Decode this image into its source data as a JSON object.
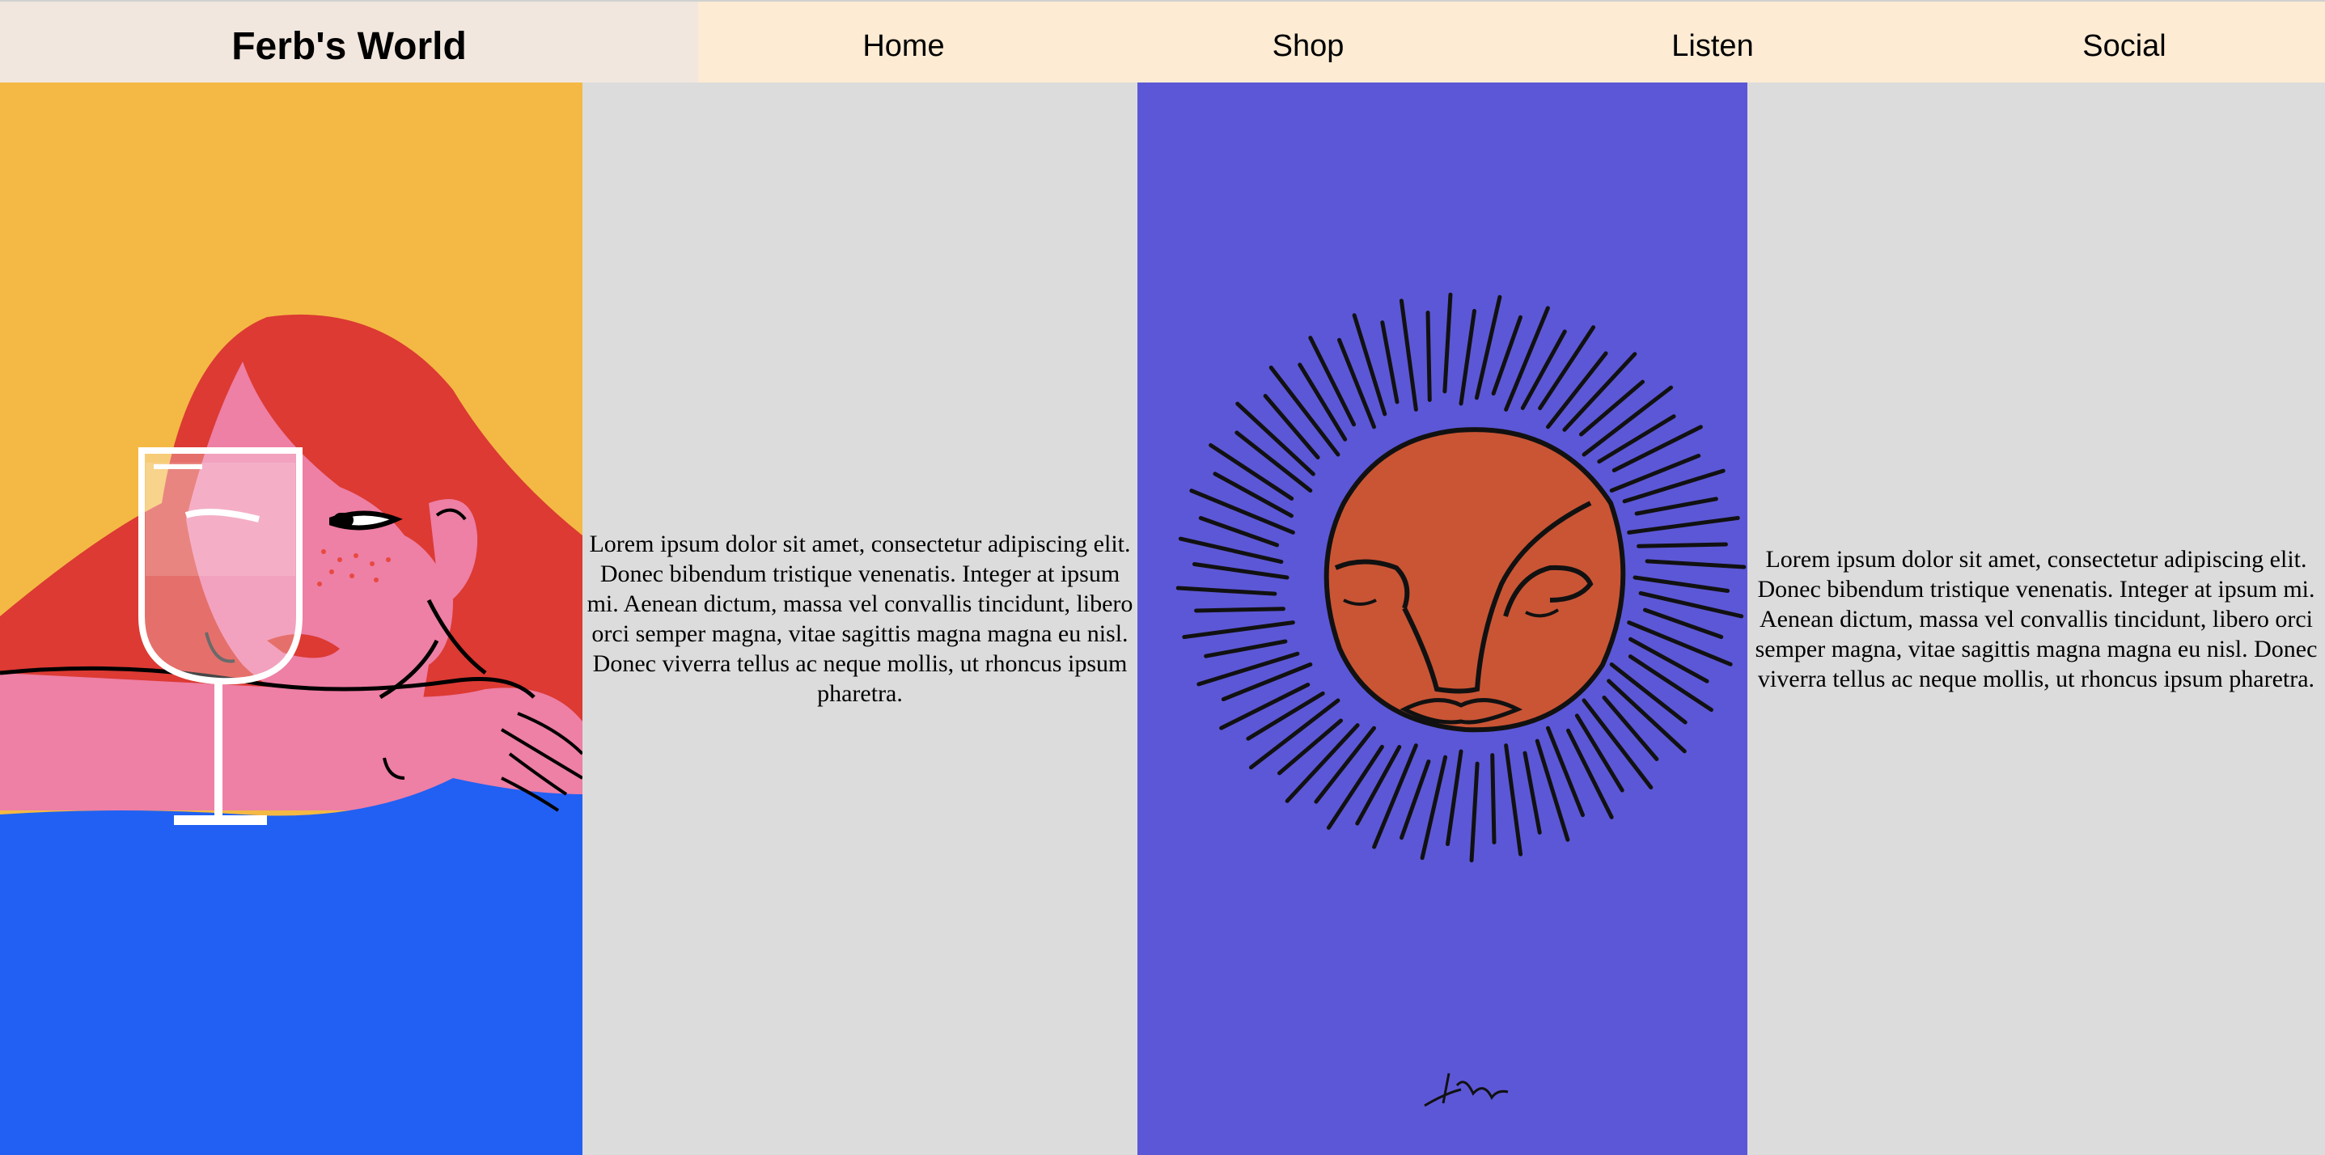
{
  "header": {
    "brand": "Ferb's World",
    "nav": [
      {
        "label": "Home"
      },
      {
        "label": "Shop"
      },
      {
        "label": "Listen"
      },
      {
        "label": "Social"
      }
    ]
  },
  "panels": {
    "text_1": "Lorem ipsum dolor sit amet, consectetur adipiscing elit. Donec bibendum tristique venenatis. Integer at ipsum mi. Aenean dictum, massa vel convallis tincidunt, libero orci semper magna, vitae sagittis magna magna eu nisl. Donec viverra tellus ac neque mollis, ut rhoncus ipsum pharetra.",
    "text_2": "Lorem ipsum dolor sit amet, consectetur adipiscing elit. Donec bibendum tristique venenatis. Integer at ipsum mi. Aenean dictum, massa vel convallis tincidunt, libero orci semper magna, vitae sagittis magna magna eu nisl. Donec viverra tellus ac neque mollis, ut rhoncus ipsum pharetra."
  },
  "colors": {
    "brand_bg": "#f1e7de",
    "nav_bg": "#fdebd3",
    "panel_bg": "#dcdcdc",
    "art1_sky": "#f4b944",
    "art1_hair": "#dc3a33",
    "art1_skin": "#ee7fa5",
    "art1_water": "#2160f2",
    "art2_bg": "#5c57d6",
    "art2_sun": "#c95535"
  }
}
